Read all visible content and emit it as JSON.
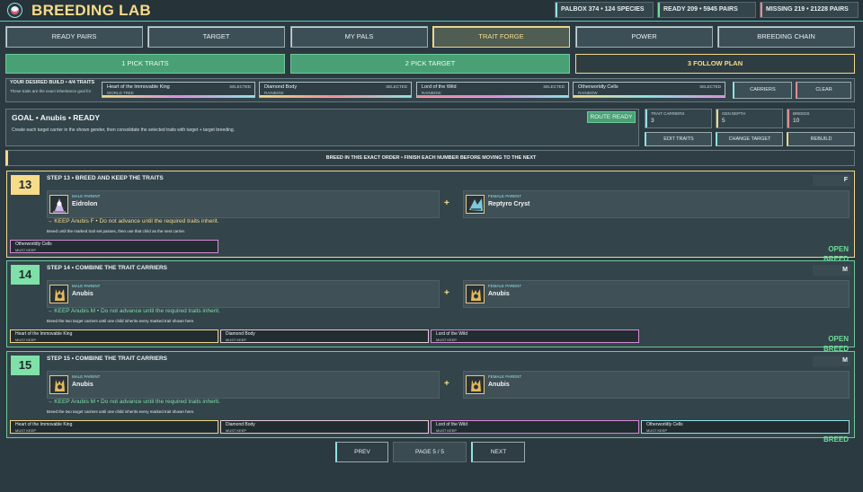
{
  "app": {
    "title": "BREEDING LAB"
  },
  "header_stats": [
    {
      "text": "PALBOX 374 • 124 SPECIES",
      "color": "#8fe3e6"
    },
    {
      "text": "READY 209 • 5945 PAIRS",
      "color": "#6fdc9a"
    },
    {
      "text": "MISSING 219 • 21228 PAIRS",
      "color": "#f08a94"
    }
  ],
  "tabs": [
    "READY PAIRS",
    "TARGET",
    "MY PALS",
    "TRAIT FORGE",
    "POWER",
    "BREEDING CHAIN"
  ],
  "active_tab": "TRAIT FORGE",
  "steps": [
    "1  PICK TRAITS",
    "2  PICK TARGET",
    "3  FOLLOW PLAN"
  ],
  "build": {
    "heading": "YOUR DESIRED BUILD • 4/4 TRAITS",
    "subheading": "These traits are the exact inheritance goal for",
    "traits": [
      {
        "name": "Heart of the Immovable King",
        "tag": "WORLD TREE",
        "selected": "SELECTED",
        "bar": [
          "#f2d88a",
          "#d88ad8",
          "#8fe3e6"
        ]
      },
      {
        "name": "Diamond Body",
        "tag": "RAINBOW",
        "selected": "SELECTED",
        "bar": [
          "#f2d88a",
          "#f08a94",
          "#8fe3e6"
        ]
      },
      {
        "name": "Lord of the Wild",
        "tag": "RAINBOW",
        "selected": "SELECTED",
        "bar": [
          "#f08a94",
          "#d88ad8",
          "#8fe3e6"
        ]
      },
      {
        "name": "Otherworldly Cells",
        "tag": "RAINBOW",
        "selected": "SELECTED",
        "bar": [
          "#f2d88a",
          "#8fe3e6",
          "#d88ad8"
        ]
      }
    ],
    "carriers_button": "CARRIERS",
    "clear_button": "CLEAR"
  },
  "goal": {
    "title": "GOAL  •  Anubis  •  READY",
    "description": "Create each target carrier in the shown gender, then consolidate the selected traits with target + target breeding.",
    "route_badge": "ROUTE READY",
    "metrics": [
      {
        "label": "TRAIT CARRIERS",
        "value": "3",
        "color": "#8fe3e6"
      },
      {
        "label": "GEN DEPTH",
        "value": "5",
        "color": "#f2d88a"
      },
      {
        "label": "BREEDS",
        "value": "10",
        "color": "#f08a94"
      }
    ],
    "edit_traits": "EDIT TRAITS",
    "change_target": "CHANGE TARGET",
    "rebuild": "REBUILD"
  },
  "order_banner": "BREED IN THIS EXACT ORDER  •  FINISH EACH NUMBER BEFORE MOVING TO THE NEXT",
  "plan_steps": [
    {
      "number": "13",
      "title": "STEP 13  •  BREED AND KEEP THE TRAITS",
      "gender": "F",
      "border": "#f2d88a",
      "badge_color": "#f6dc8a",
      "male_label": "MALE PARENT",
      "male_name": "Eidrolon",
      "female_label": "FEMALE PARENT",
      "female_name": "Reptyro Cryst",
      "keep_text": "→  KEEP Anubis  F  •  Do not advance until the required traits inherit.",
      "keep_color": "#f6dc8a",
      "note": "Breed until the marked trait set passes, then use that child as the next carrier.",
      "traits": [
        {
          "name": "Otherworldly Cells",
          "keep": "MUST KEEP"
        }
      ],
      "status": "OPEN BREED"
    },
    {
      "number": "14",
      "title": "STEP 14  •  COMBINE THE TRAIT CARRIERS",
      "gender": "M",
      "border": "#6dc89a",
      "badge_color": "#7fe0a8",
      "male_label": "MALE PARENT",
      "male_name": "Anubis",
      "female_label": "FEMALE PARENT",
      "female_name": "Anubis",
      "keep_text": "→  KEEP Anubis  M  •  Do not advance until the required traits inherit.",
      "keep_color": "#7fe0a8",
      "note": "Breed the two target carriers until one child inherits every marked trait shown here.",
      "traits": [
        {
          "name": "Heart of the Immovable King",
          "keep": "MUST KEEP"
        },
        {
          "name": "Diamond Body",
          "keep": "MUST KEEP"
        },
        {
          "name": "Lord of the Wild",
          "keep": "MUST KEEP"
        }
      ],
      "status": "OPEN BREED"
    },
    {
      "number": "15",
      "title": "STEP 15  •  COMBINE THE TRAIT CARRIERS",
      "gender": "M",
      "border": "#6dc89a",
      "badge_color": "#7fe0a8",
      "male_label": "MALE PARENT",
      "male_name": "Anubis",
      "female_label": "FEMALE PARENT",
      "female_name": "Anubis",
      "keep_text": "→  KEEP Anubis  M  •  Do not advance until the required traits inherit.",
      "keep_color": "#7fe0a8",
      "note": "Breed the two target carriers until one child inherits every marked trait shown here.",
      "traits": [
        {
          "name": "Heart of the Immovable King",
          "keep": "MUST KEEP"
        },
        {
          "name": "Diamond Body",
          "keep": "MUST KEEP"
        },
        {
          "name": "Lord of the Wild",
          "keep": "MUST KEEP"
        },
        {
          "name": "Otherworldly Cells",
          "keep": "MUST KEEP"
        }
      ],
      "status": "BREED"
    }
  ],
  "pagination": {
    "prev": "PREV",
    "page": "PAGE  5 / 5",
    "next": "NEXT"
  }
}
